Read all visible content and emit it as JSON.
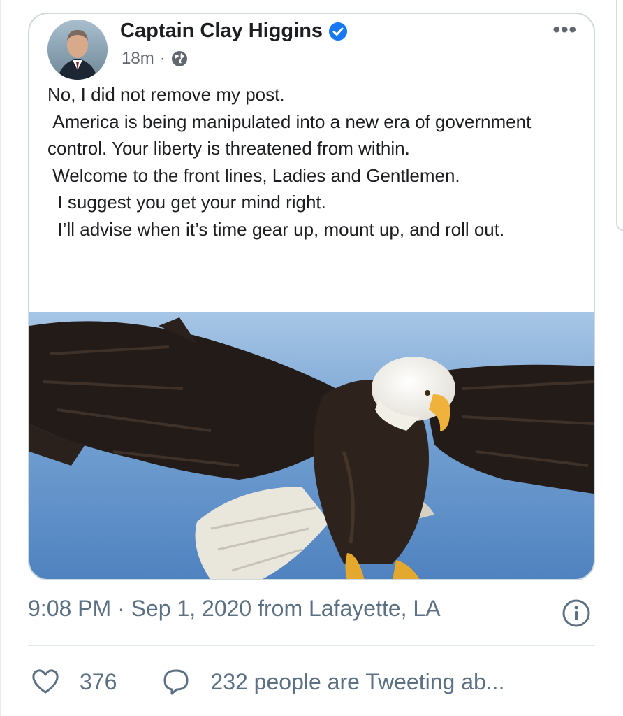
{
  "post": {
    "author": "Captain Clay Higgins",
    "time_ago": "18m",
    "separator": "·",
    "verified_icon": "verified-badge-icon",
    "privacy_icon": "globe-icon",
    "more_icon": "•••",
    "text": "No, I did not remove my post.\n America is being manipulated into a new era of government control. Your liberty is threatened from within.\n Welcome to the front lines, Ladies and Gentlemen.\n  I suggest you get your mind right.\n  I’ll advise when it’s time gear up, mount up, and roll out.",
    "image": "bald-eagle-photo"
  },
  "tweet": {
    "timestamp": "9:08 PM · Sep 1, 2020 from Lafayette, LA",
    "info_icon": "info-icon",
    "likes": "376",
    "like_icon": "heart-icon",
    "reply_text": "232 people are Tweeting ab...",
    "reply_icon": "speech-bubble-icon"
  },
  "colors": {
    "verified_blue": "#1877f2",
    "meta_gray": "#606770",
    "tweet_gray": "#5b7083",
    "sky": "#6f9dd0"
  }
}
